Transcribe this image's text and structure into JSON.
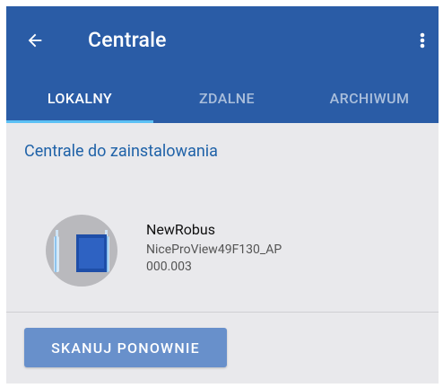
{
  "appbar": {
    "title": "Centrale",
    "back_icon": "arrow-left-icon",
    "more_icon": "more-vertical-icon",
    "background_color": "#2a5ca6"
  },
  "tabs": [
    {
      "label": "LOKALNY",
      "active": true
    },
    {
      "label": "ZDALNE",
      "active": false
    },
    {
      "label": "ARCHIWUM",
      "active": false
    }
  ],
  "main": {
    "section_title": "Centrale do zainstalowania",
    "devices": [
      {
        "name": "NewRobus",
        "ssid": "NiceProView49F130_AP",
        "version": "000.003",
        "icon": "control-unit-icon"
      }
    ],
    "rescan_button": "SKANUJ PONOWNIE"
  },
  "colors": {
    "accent": "#2a5ca6",
    "tab_indicator": "#5cc1f5",
    "section_title": "#1f62a8",
    "button": "#6890cb",
    "background": "#e9e9ec"
  }
}
